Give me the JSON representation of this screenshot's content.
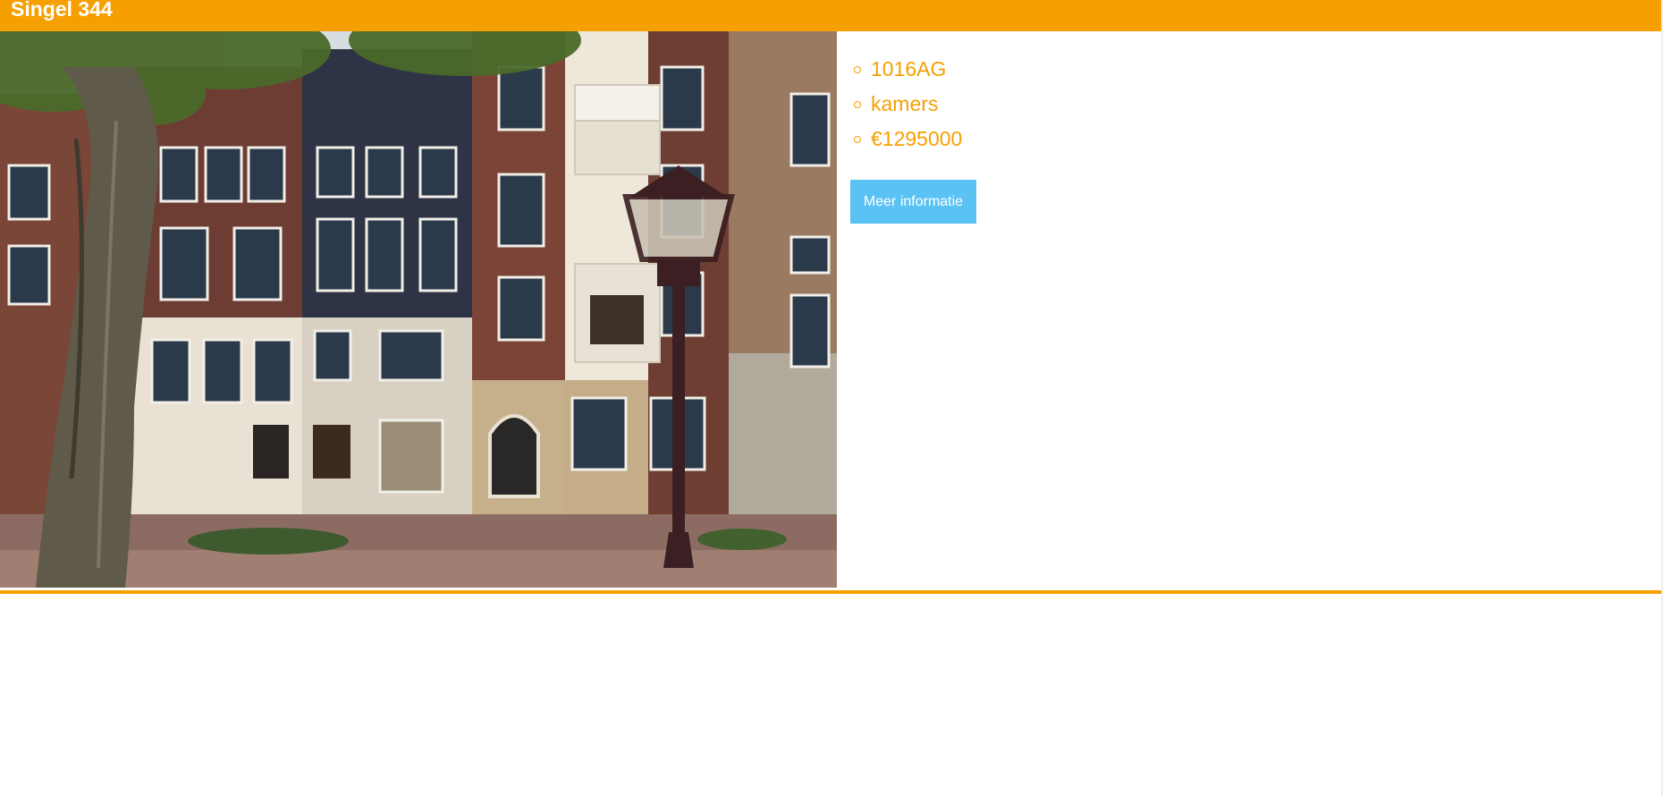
{
  "listing": {
    "title": "Singel 344",
    "details": [
      {
        "value": "1016AG"
      },
      {
        "value": "kamers"
      },
      {
        "value": "€1295000"
      }
    ],
    "more_button_label": "Meer informatie"
  },
  "colors": {
    "accent": "#f5a000",
    "button": "#5bc2f4"
  },
  "icons": {
    "list_bullet": "circle-outline-icon"
  }
}
